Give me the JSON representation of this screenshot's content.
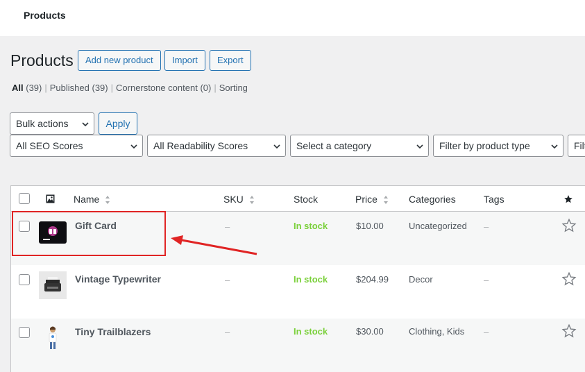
{
  "topbar": {
    "title": "Products"
  },
  "header": {
    "title": "Products",
    "add_new_label": "Add new product",
    "import_label": "Import",
    "export_label": "Export"
  },
  "views": {
    "all_label": "All",
    "all_count": "(39)",
    "published_label": "Published",
    "published_count": "(39)",
    "cornerstone_label": "Cornerstone content",
    "cornerstone_count": "(0)",
    "sorting_label": "Sorting",
    "separator": "|"
  },
  "filters": {
    "bulk_actions": "Bulk actions",
    "apply_label": "Apply",
    "seo_scores": "All SEO Scores",
    "readability_scores": "All Readability Scores",
    "category": "Select a category",
    "product_type": "Filter by product type",
    "stock_filter_partial": "Filt"
  },
  "table": {
    "columns": {
      "name": "Name",
      "sku": "SKU",
      "stock": "Stock",
      "price": "Price",
      "categories": "Categories",
      "tags": "Tags"
    },
    "rows": [
      {
        "name": "Gift Card",
        "sku": "–",
        "stock": "In stock",
        "price": "$10.00",
        "categories": "Uncategorized",
        "tags": "–"
      },
      {
        "name": "Vintage Typewriter",
        "sku": "–",
        "stock": "In stock",
        "price": "$204.99",
        "categories": "Decor",
        "tags": "–"
      },
      {
        "name": "Tiny Trailblazers",
        "sku": "–",
        "stock": "In stock",
        "price": "$30.00",
        "categories": "Clothing, Kids",
        "tags": "–"
      }
    ]
  },
  "colors": {
    "accent": "#2271b1",
    "in_stock": "#7ad03a",
    "annotation": "#e02424"
  }
}
